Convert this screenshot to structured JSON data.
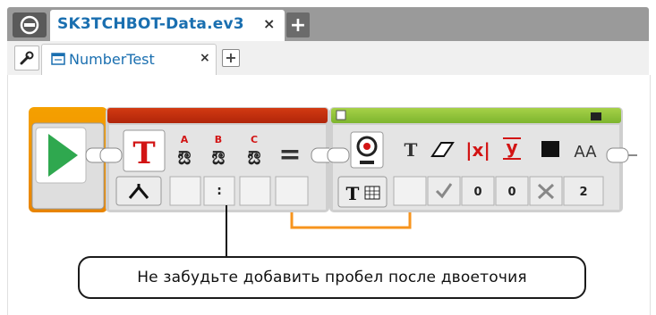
{
  "project_tabs": {
    "active_label": "SK3TCHBOT-Data.ev3",
    "close_glyph": "×",
    "add_glyph": "+"
  },
  "program_tabs": {
    "active_label": "NumberTest",
    "close_glyph": "×",
    "add_glyph": "+"
  },
  "text_block": {
    "inputs": [
      "A",
      "B",
      "C"
    ],
    "symbol": "T",
    "equals": "=",
    "input_b_value": ":"
  },
  "display_block": {
    "text_symbol": "T",
    "x_label": "x",
    "y_label": "y",
    "font_label": "AA",
    "values": [
      "0",
      "0",
      "2"
    ]
  },
  "callout": {
    "text": "Не забудьте добавить пробел после двоеточия"
  },
  "colors": {
    "start_orange": "#f5a000",
    "text_block_red": "#c62b0e",
    "display_block_green": "#8cc63f",
    "wire_orange": "#f7941e",
    "tab_blue": "#1a6fb0"
  }
}
